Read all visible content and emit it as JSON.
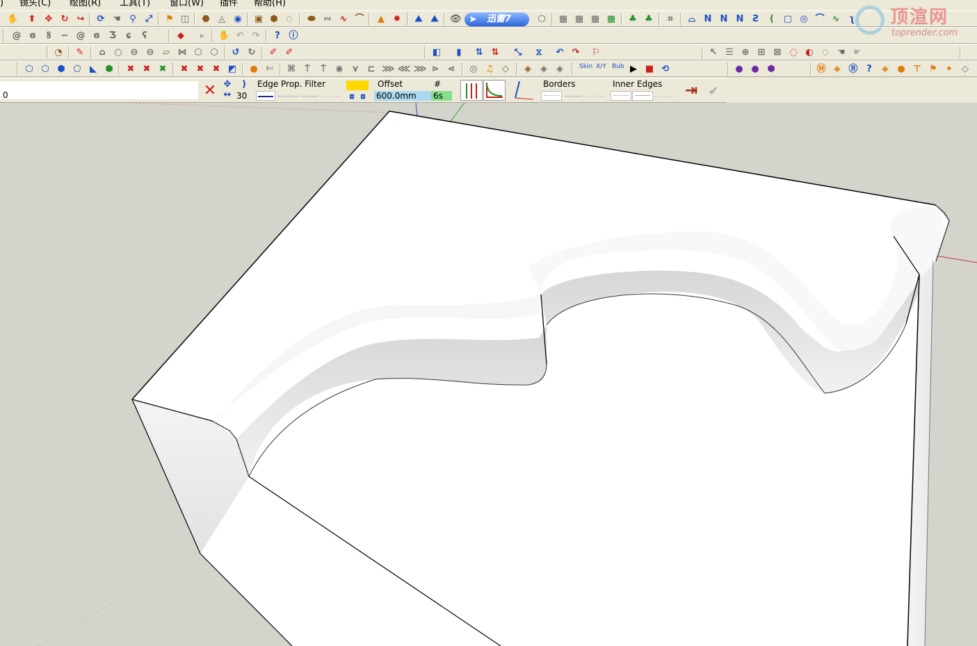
{
  "menu": {
    "items": [
      "镜头(C)",
      "绘图(R)",
      "工具(T)",
      "窗口(W)",
      "插件",
      "帮助(H)"
    ],
    "leading_fragment": ")"
  },
  "toolbar": {
    "xunlei_label": "迅雷7"
  },
  "watermark": {
    "title": "顶渲网",
    "url": "toprender.com"
  },
  "status": {
    "measurements_value": "0",
    "angle_value": "30",
    "edge_filter_label": "Edge Prop. Filter",
    "offset_label": "Offset",
    "offset_value": "600.0mm",
    "count_label": "#",
    "count_value": "6s",
    "borders_label": "Borders",
    "inner_edges_label": "Inner Edges",
    "mini_toolbar_labels": [
      "Skin",
      "X/Y",
      "Bub"
    ]
  },
  "icons": {
    "row1": [
      "magnifier-icon",
      "box-icon",
      "orbit-icon",
      "pan-icon",
      "zoom-icon",
      "zoom-extents-icon",
      "paint-bucket-icon",
      "eraser-icon",
      "component-icon",
      "follow-me-icon",
      "offset-icon",
      "push-pull-icon",
      "move-icon",
      "rotate-icon",
      "scale-icon"
    ],
    "accent_colors": {
      "toolbar_bg": "#ece9d8",
      "viewport_bg": "#d4d4cc",
      "model_face": "#ffffff",
      "axis_red": "#cc3333",
      "axis_green": "#2aa62a",
      "axis_blue": "#3344cc"
    }
  }
}
